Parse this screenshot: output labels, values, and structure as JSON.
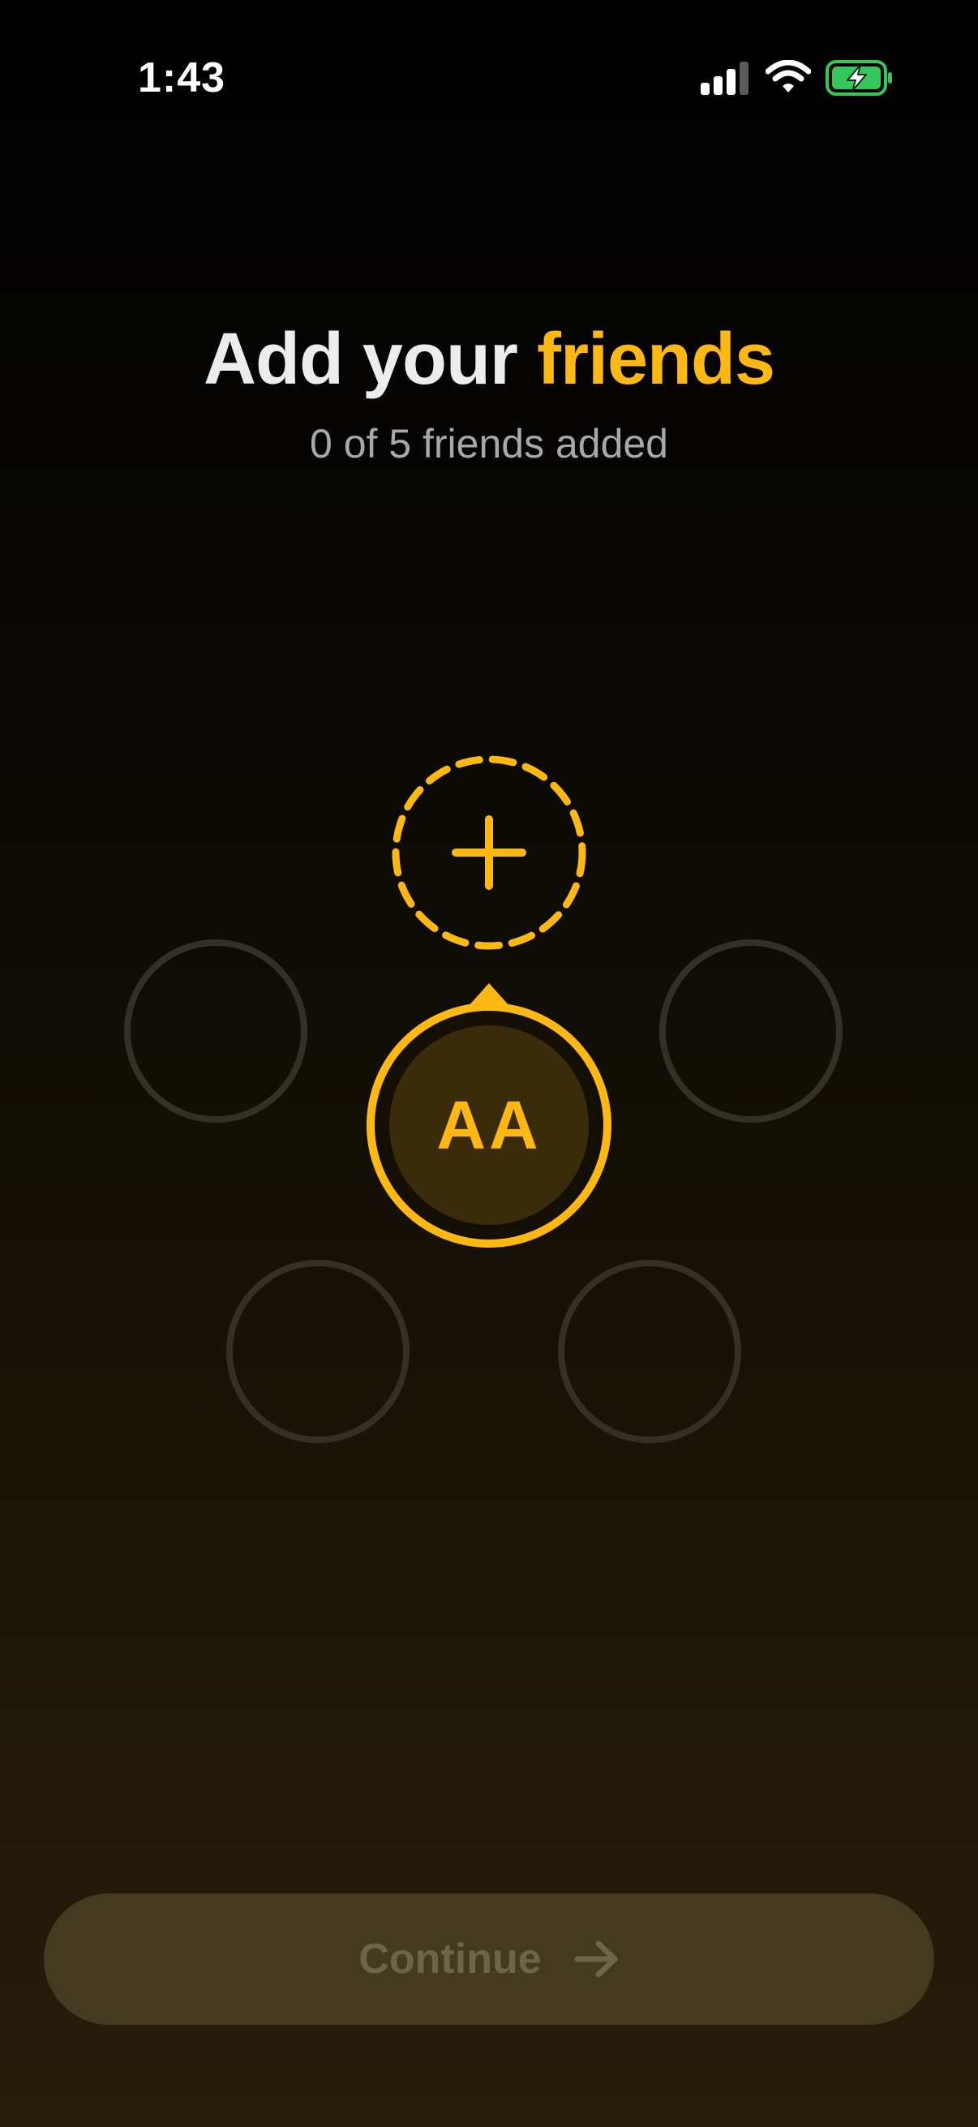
{
  "status_bar": {
    "time": "1:43",
    "icons": [
      "cellular-signal-icon",
      "wifi-icon",
      "battery-charging-icon"
    ],
    "battery_color": "#34c759"
  },
  "header": {
    "title_prefix": "Add your ",
    "title_highlight": "friends",
    "subtitle": "0 of 5 friends added"
  },
  "friends": {
    "added_count": 0,
    "max_count": 5,
    "add_icon": "plus-icon",
    "self_initials": "AA"
  },
  "continue_button": {
    "label": "Continue",
    "icon": "arrow-right-icon"
  },
  "colors": {
    "accent": "#fdb813",
    "empty_slot_border": "#343028",
    "button_bg": "#433a20",
    "button_text": "#6d6548"
  }
}
